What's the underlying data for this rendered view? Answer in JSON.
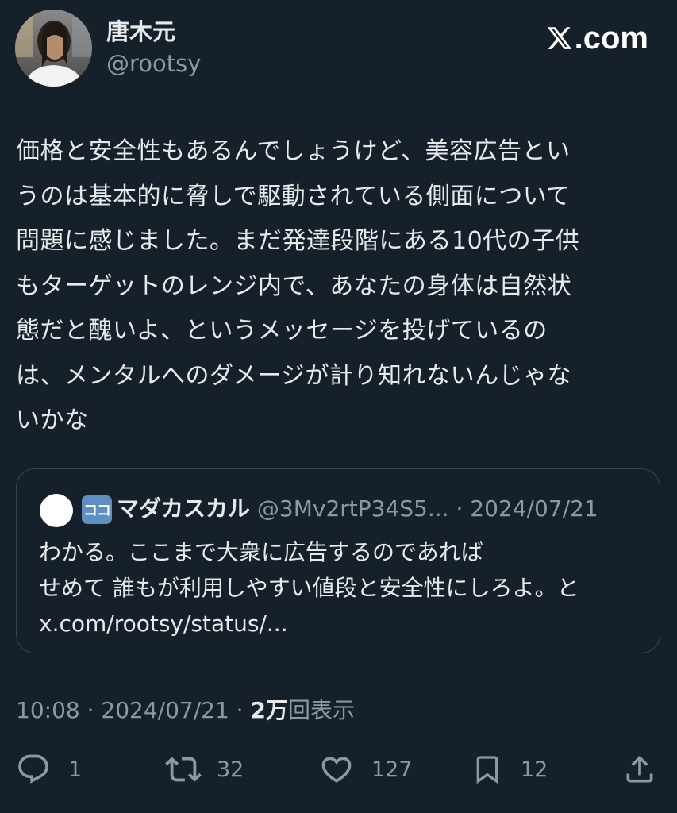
{
  "author": {
    "name": "唐木元",
    "handle": "@rootsy"
  },
  "brand": {
    "label": ".com",
    "icon": "x-logo-icon"
  },
  "tweet": {
    "lines": [
      "価格と安全性もあるんでしょうけど、美容広告とい",
      "うのは基本的に脅しで駆動されている側面について",
      "問題に感じました。まだ発達段階にある10代の子供",
      "もターゲットのレンジ内で、あなたの身体は自然状",
      "態だと醜いよ、というメッセージを投げているの",
      "は、メンタルへのダメージが計り知れないんじゃな",
      "いかな"
    ]
  },
  "quote": {
    "badge": "ココ",
    "name": "マダカスカル",
    "meta": " @3Mv2rtP34S5... · 2024/07/21",
    "lines": [
      "わかる。ここまで大衆に広告するのであれば",
      "せめて 誰もが利用しやすい値段と安全性にしろよ。と",
      "x.com/rootsy/status/..."
    ]
  },
  "meta": {
    "datetime": "10:08 · 2024/07/21 · ",
    "views_count": "2万",
    "views_label": "回表示"
  },
  "actions": {
    "replies": "1",
    "reposts": "32",
    "likes": "127",
    "bookmarks": "12"
  },
  "colors": {
    "background": "#15202b",
    "text": "#e7e9ea",
    "muted": "#8b98a5",
    "border": "#38444d"
  }
}
